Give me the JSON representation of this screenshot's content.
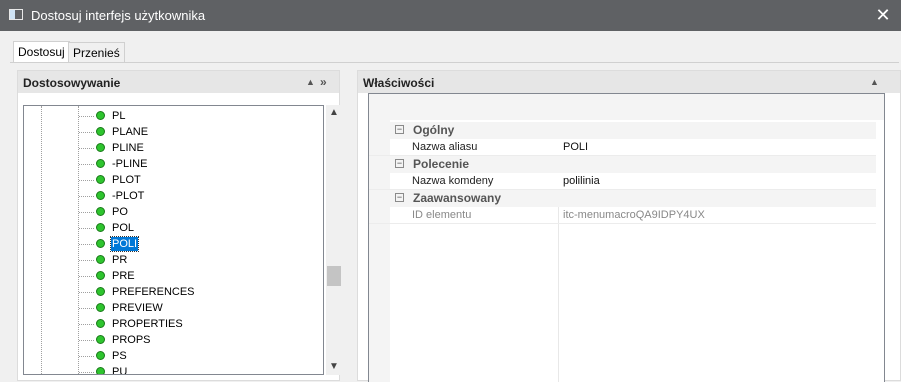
{
  "window": {
    "title": "Dostosuj interfejs użytkownika",
    "close_glyph": "✕"
  },
  "tabs": [
    {
      "label": "Dostosuj"
    },
    {
      "label": "Przenieś"
    }
  ],
  "left_panel": {
    "header": "Dostosowywanie",
    "items": [
      "PL",
      "PLANE",
      "PLINE",
      "-PLINE",
      "PLOT",
      "-PLOT",
      "PO",
      "POL",
      "POLI",
      "PR",
      "PRE",
      "PREFERENCES",
      "PREVIEW",
      "PROPERTIES",
      "PROPS",
      "PS",
      "PU"
    ],
    "selected": "POLI"
  },
  "right_panel": {
    "header": "Właściwości",
    "categories": [
      {
        "name": "Ogólny",
        "props": [
          {
            "name": "Nazwa aliasu",
            "value": "POLI"
          }
        ]
      },
      {
        "name": "Polecenie",
        "props": [
          {
            "name": "Nazwa komdeny",
            "value": "polilinia"
          }
        ]
      },
      {
        "name": "Zaawansowany",
        "props": [
          {
            "name": "ID elementu",
            "value": "itc-menumacroQA9IDPY4UX"
          }
        ]
      }
    ]
  },
  "icons": {
    "collapse_up": "▲",
    "expand_right": "»",
    "scroll_up": "▲",
    "scroll_down": "▼",
    "category_toggle": "−"
  },
  "colors": {
    "titlebar": "#5f6164",
    "selection": "#0078d7",
    "node_dot": "#2ec42e"
  }
}
